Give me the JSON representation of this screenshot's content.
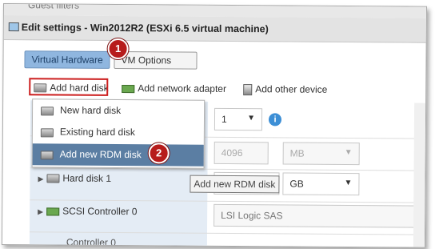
{
  "background_window": {
    "partial_text": "Guest filters"
  },
  "dialog": {
    "title": "Edit settings - Win2012R2 (ESXi 6.5 virtual machine)"
  },
  "tabs": [
    {
      "label": "Virtual Hardware",
      "active": true
    },
    {
      "label": "VM Options",
      "active": false
    }
  ],
  "toolbar": {
    "add_hard_disk": "Add hard disk",
    "add_network_adapter": "Add network adapter",
    "add_other_device": "Add other device"
  },
  "dropdown_menu": {
    "items": [
      {
        "label": "New hard disk",
        "selected": false
      },
      {
        "label": "Existing hard disk",
        "selected": false
      },
      {
        "label": "Add new RDM disk",
        "selected": true
      }
    ]
  },
  "hardware_rows": {
    "cpu_select_value": "1",
    "memory_value": "4096",
    "memory_unit": "MB",
    "hard_disk_label": "Hard disk 1",
    "hard_disk_unit": "GB",
    "scsi_label": "SCSI Controller 0",
    "scsi_value": "LSI Logic SAS",
    "partial_row_label": "Controller 0"
  },
  "tooltip": {
    "text": "Add new RDM disk"
  },
  "step_badges": [
    "1",
    "2"
  ],
  "colors": {
    "accent_tab": "#8fb6df",
    "menu_highlight": "#5b7ea3",
    "badge_red": "#b71c1c",
    "highlight_border": "#cc1f1f"
  }
}
